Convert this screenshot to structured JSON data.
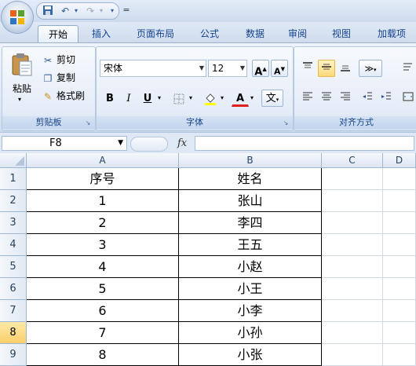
{
  "quick_access": {
    "save_icon": "save-icon",
    "undo_icon": "undo-icon",
    "redo_icon": "redo-icon",
    "menu_glyph": "="
  },
  "tabs": [
    {
      "label": "开始",
      "active": true
    },
    {
      "label": "插入"
    },
    {
      "label": "页面布局"
    },
    {
      "label": "公式"
    },
    {
      "label": "数据"
    },
    {
      "label": "审阅"
    },
    {
      "label": "视图"
    },
    {
      "label": "加载项"
    }
  ],
  "ribbon": {
    "clipboard": {
      "paste_label": "粘贴",
      "cut_label": "剪切",
      "copy_label": "复制",
      "format_painter_label": "格式刷",
      "group_label": "剪贴板"
    },
    "font": {
      "font_name": "宋体",
      "font_size": "12",
      "bold": "B",
      "italic": "I",
      "underline": "U",
      "grow": "A",
      "shrink": "A",
      "font_color_glyph": "A",
      "phonetic_glyph": "文",
      "group_label": "字体"
    },
    "alignment": {
      "group_label": "对齐方式"
    }
  },
  "formula_bar": {
    "name_box": "F8",
    "fx_label": "fx",
    "formula": ""
  },
  "sheet": {
    "columns": [
      "A",
      "B",
      "C",
      "D"
    ],
    "rows": [
      "1",
      "2",
      "3",
      "4",
      "5",
      "6",
      "7",
      "8",
      "9"
    ],
    "active_row": "8",
    "data": [
      [
        "序号",
        "姓名"
      ],
      [
        "1",
        "张山"
      ],
      [
        "2",
        "李四"
      ],
      [
        "3",
        "王五"
      ],
      [
        "4",
        "小赵"
      ],
      [
        "5",
        "小王"
      ],
      [
        "6",
        "小李"
      ],
      [
        "7",
        "小孙"
      ],
      [
        "8",
        "小张"
      ]
    ]
  },
  "colors": {
    "accent": "#15428b",
    "active_highlight": "#f9cf6a"
  }
}
